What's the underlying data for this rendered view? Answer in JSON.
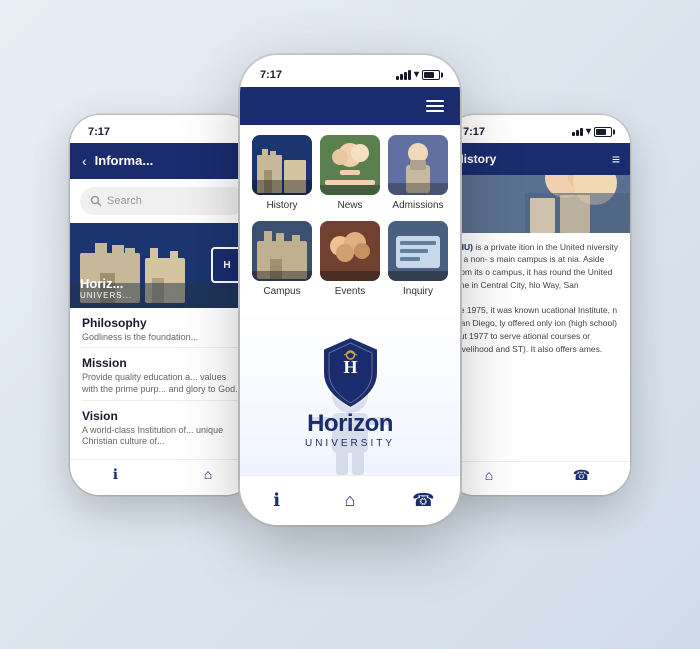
{
  "left_phone": {
    "time": "7:17",
    "nav_title": "Informa...",
    "search_placeholder": "Search",
    "hero_name": "Horiz...",
    "hero_sub": "UNIVERS...",
    "logo_letter": "H",
    "sections": [
      {
        "title": "Philosophy",
        "text": "Godliness is the foundation..."
      },
      {
        "title": "Mission",
        "text": "Provide quality education a... values with the prime purp... and glory to God."
      },
      {
        "title": "Vision",
        "text": "A world-class Institution of... unique Christian culture of..."
      }
    ]
  },
  "center_phone": {
    "time": "7:17",
    "menu_items": [
      {
        "label": "History",
        "thumb": "history"
      },
      {
        "label": "News",
        "thumb": "news"
      },
      {
        "label": "Admissions",
        "thumb": "admissions"
      },
      {
        "label": "Campus",
        "thumb": "campus"
      },
      {
        "label": "Events",
        "thumb": "events"
      },
      {
        "label": "Inquiry",
        "thumb": "inquiry"
      }
    ],
    "splash_name": "Horizon",
    "splash_sub": "UNIVERSITY"
  },
  "right_phone": {
    "time": "7:17",
    "nav_title": "History",
    "text_content": "(HU) is a private ition in the United niversity is a non- s main campus is at nia. Aside from its o campus, it has round the United one in Central City, hlo Way, San\n\nne 1975, it was known ucational Institute, n San Diego, ly offered only ion (high school) but 1977 to serve ational courses or Livelihood and ST). It also offers ames.",
    "is_private_label": "is a private"
  },
  "icons": {
    "back": "‹",
    "menu": "≡",
    "info": "ℹ",
    "home": "⌂",
    "phone": "☎",
    "search": "🔍"
  }
}
